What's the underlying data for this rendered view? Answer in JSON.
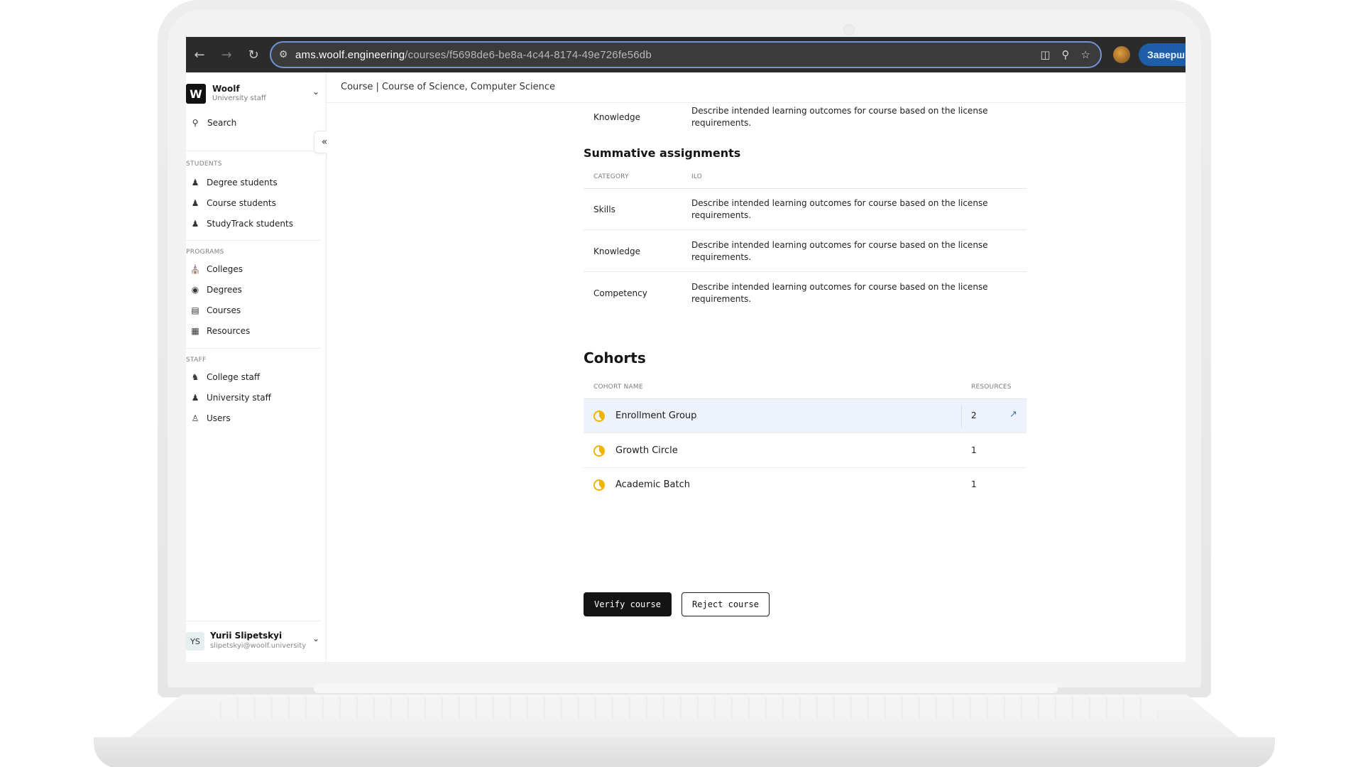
{
  "browser": {
    "url_host": "ams.woolf.engineering",
    "url_path": "/courses/f5698de6-be8a-4c44-8174-49e726fe56db",
    "finish_button": "Заверш"
  },
  "sidebar": {
    "org_logo": "W",
    "org_name": "Woolf",
    "org_role": "University staff",
    "search_label": "Search",
    "sections": {
      "students": "STUDENTS",
      "programs": "PROGRAMS",
      "staff": "STAFF"
    },
    "students_items": [
      "Degree students",
      "Course students",
      "StudyTrack students"
    ],
    "programs_items": [
      "Colleges",
      "Degrees",
      "Courses",
      "Resources"
    ],
    "staff_items": [
      "College staff",
      "University staff",
      "Users"
    ],
    "user": {
      "initials": "YS",
      "name": "Yurii Slipetskyi",
      "email": "slipetskyi@woolf.university"
    }
  },
  "main": {
    "breadcrumb": "Course | Course of Science, Computer Science",
    "previous_row": {
      "category": "Knowledge",
      "ilo": "Describe intended learning outcomes for course based on the license requirements."
    },
    "summative": {
      "title": "Summative assignments",
      "col_category": "CATEGORY",
      "col_ilo": "ILO",
      "rows": [
        {
          "category": "Skills",
          "ilo": "Describe intended learning outcomes for course based on the license requirements."
        },
        {
          "category": "Knowledge",
          "ilo": "Describe intended learning outcomes for course based on the license requirements."
        },
        {
          "category": "Competency",
          "ilo": "Describe intended learning outcomes for course based on the license requirements."
        }
      ]
    },
    "cohorts": {
      "title": "Cohorts",
      "col_name": "COHORT NAME",
      "col_resources": "RESOURCES",
      "rows": [
        {
          "name": "Enrollment Group",
          "resources": "2"
        },
        {
          "name": "Growth Circle",
          "resources": "1"
        },
        {
          "name": "Academic Batch",
          "resources": "1"
        }
      ]
    },
    "actions": {
      "verify": "Verify course",
      "reject": "Reject course"
    }
  }
}
